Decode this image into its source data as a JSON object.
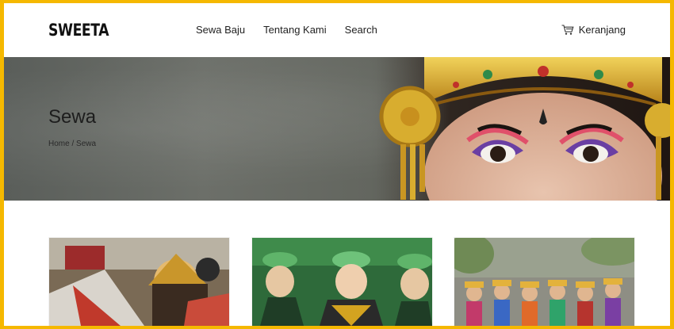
{
  "header": {
    "logo": "SWEETA",
    "nav": [
      {
        "label": "Sewa Baju"
      },
      {
        "label": "Tentang Kami"
      },
      {
        "label": "Search"
      }
    ],
    "cart_label": "Keranjang",
    "cart_icon": "shopping-cart-icon"
  },
  "hero": {
    "title": "Sewa",
    "breadcrumb": {
      "home": "Home",
      "separator": " / ",
      "current": "Sewa"
    }
  },
  "products": [
    {
      "name": "product-image-1"
    },
    {
      "name": "product-image-2"
    },
    {
      "name": "product-image-3"
    }
  ],
  "colors": {
    "frame_border": "#f5b800",
    "accent_gold": "#d4a21b"
  }
}
